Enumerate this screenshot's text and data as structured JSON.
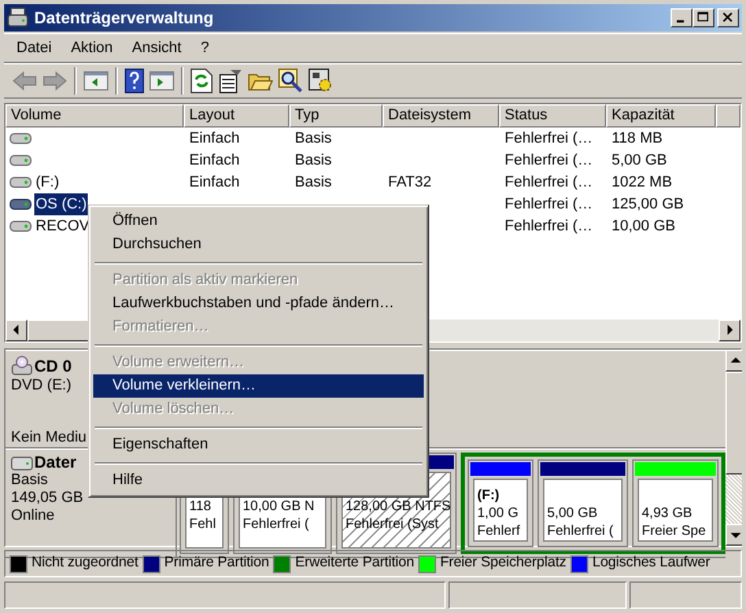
{
  "window": {
    "title": "Datenträgerverwaltung"
  },
  "menu": [
    "Datei",
    "Aktion",
    "Ansicht",
    "?"
  ],
  "toolbar": [
    {
      "kind": "back",
      "disabled": true
    },
    {
      "kind": "forward",
      "disabled": true
    },
    {
      "kind": "separator"
    },
    {
      "kind": "tree"
    },
    {
      "kind": "separator"
    },
    {
      "kind": "help"
    },
    {
      "kind": "pane"
    },
    {
      "kind": "separator"
    },
    {
      "kind": "refresh"
    },
    {
      "kind": "properties"
    },
    {
      "kind": "folder"
    },
    {
      "kind": "search"
    },
    {
      "kind": "settings"
    }
  ],
  "volumes": {
    "columns": [
      "Volume",
      "Layout",
      "Typ",
      "Dateisystem",
      "Status",
      "Kapazität"
    ],
    "rows": [
      {
        "volume": "",
        "layout": "Einfach",
        "type": "Basis",
        "status": "Fehlerfrei (…",
        "capacity": "118 MB",
        "selected": false
      },
      {
        "volume": "",
        "layout": "Einfach",
        "type": "Basis",
        "status": "Fehlerfrei (…",
        "capacity": "5,00 GB",
        "selected": false
      },
      {
        "volume": "(F:)",
        "layout": "Einfach",
        "type": "Basis",
        "file_system": "FAT32",
        "status": "Fehlerfrei (…",
        "capacity": "1022 MB",
        "selected": false
      },
      {
        "volume": "OS (C:)",
        "status": "Fehlerfrei (…",
        "capacity": "125,00 GB",
        "selected": true
      },
      {
        "volume": "RECOV",
        "status": "Fehlerfrei (…",
        "capacity": "10,00 GB",
        "selected": false
      }
    ]
  },
  "disks": [
    {
      "kind": "cdrom",
      "name": "CD 0",
      "type": "DVD (E:)",
      "status": "Kein Mediu"
    },
    {
      "kind": "disk",
      "name": "Dater",
      "type": "Basis",
      "size": "149,05 GB",
      "status": "Online",
      "partitions": [
        {
          "kind": "primary",
          "lines": [
            "118",
            "Fehl"
          ],
          "selected": false
        },
        {
          "kind": "primary",
          "lines": [
            "10,00 GB N",
            "Fehlerfrei ("
          ],
          "selected": false
        },
        {
          "kind": "primary",
          "color": "#000080",
          "lines": [
            "128,00 GB NTFS",
            "Fehlerfrei (Syst"
          ],
          "selected": true
        },
        {
          "kind": "extended",
          "color": "#008000",
          "children": [
            {
              "color": "#0000ff",
              "title": "(F:)",
              "lines": [
                "1,00 G",
                "Fehlerf"
              ],
              "selected": false
            },
            {
              "color": "#000080",
              "lines": [
                "5,00 GB",
                "Fehlerfrei ("
              ],
              "selected": false
            },
            {
              "color": "#00ff00",
              "lines": [
                "4,93 GB",
                "Freier Spe"
              ],
              "selected": false
            }
          ]
        }
      ]
    }
  ],
  "legend": [
    {
      "label": "Nicht zugeordnet",
      "color": "#000000"
    },
    {
      "label": "Primäre Partition",
      "color": "#000080"
    },
    {
      "label": "Erweiterte Partition",
      "color": "#008000"
    },
    {
      "label": "Freier Speicherplatz",
      "color": "#00ff00"
    },
    {
      "label": "Logisches Laufwer",
      "color": "#0000ff"
    }
  ],
  "context_menu": [
    {
      "kind": "item",
      "label": "Öffnen",
      "disabled": false,
      "selected": false
    },
    {
      "kind": "item",
      "label": "Durchsuchen",
      "disabled": false,
      "selected": false
    },
    {
      "kind": "separator"
    },
    {
      "kind": "item",
      "label": "Partition als aktiv markieren",
      "disabled": true,
      "selected": false
    },
    {
      "kind": "item",
      "label": "Laufwerkbuchstaben und -pfade ändern…",
      "disabled": false,
      "selected": false
    },
    {
      "kind": "item",
      "label": "Formatieren…",
      "disabled": true,
      "selected": false
    },
    {
      "kind": "separator"
    },
    {
      "kind": "item",
      "label": "Volume erweitern…",
      "disabled": true,
      "selected": false
    },
    {
      "kind": "item",
      "label": "Volume verkleinern…",
      "disabled": false,
      "selected": true
    },
    {
      "kind": "item",
      "label": "Volume löschen…",
      "disabled": true,
      "selected": false
    },
    {
      "kind": "separator"
    },
    {
      "kind": "item",
      "label": "Eigenschaften",
      "disabled": false,
      "selected": false
    },
    {
      "kind": "separator"
    },
    {
      "kind": "item",
      "label": "Hilfe",
      "disabled": false,
      "selected": false
    }
  ]
}
